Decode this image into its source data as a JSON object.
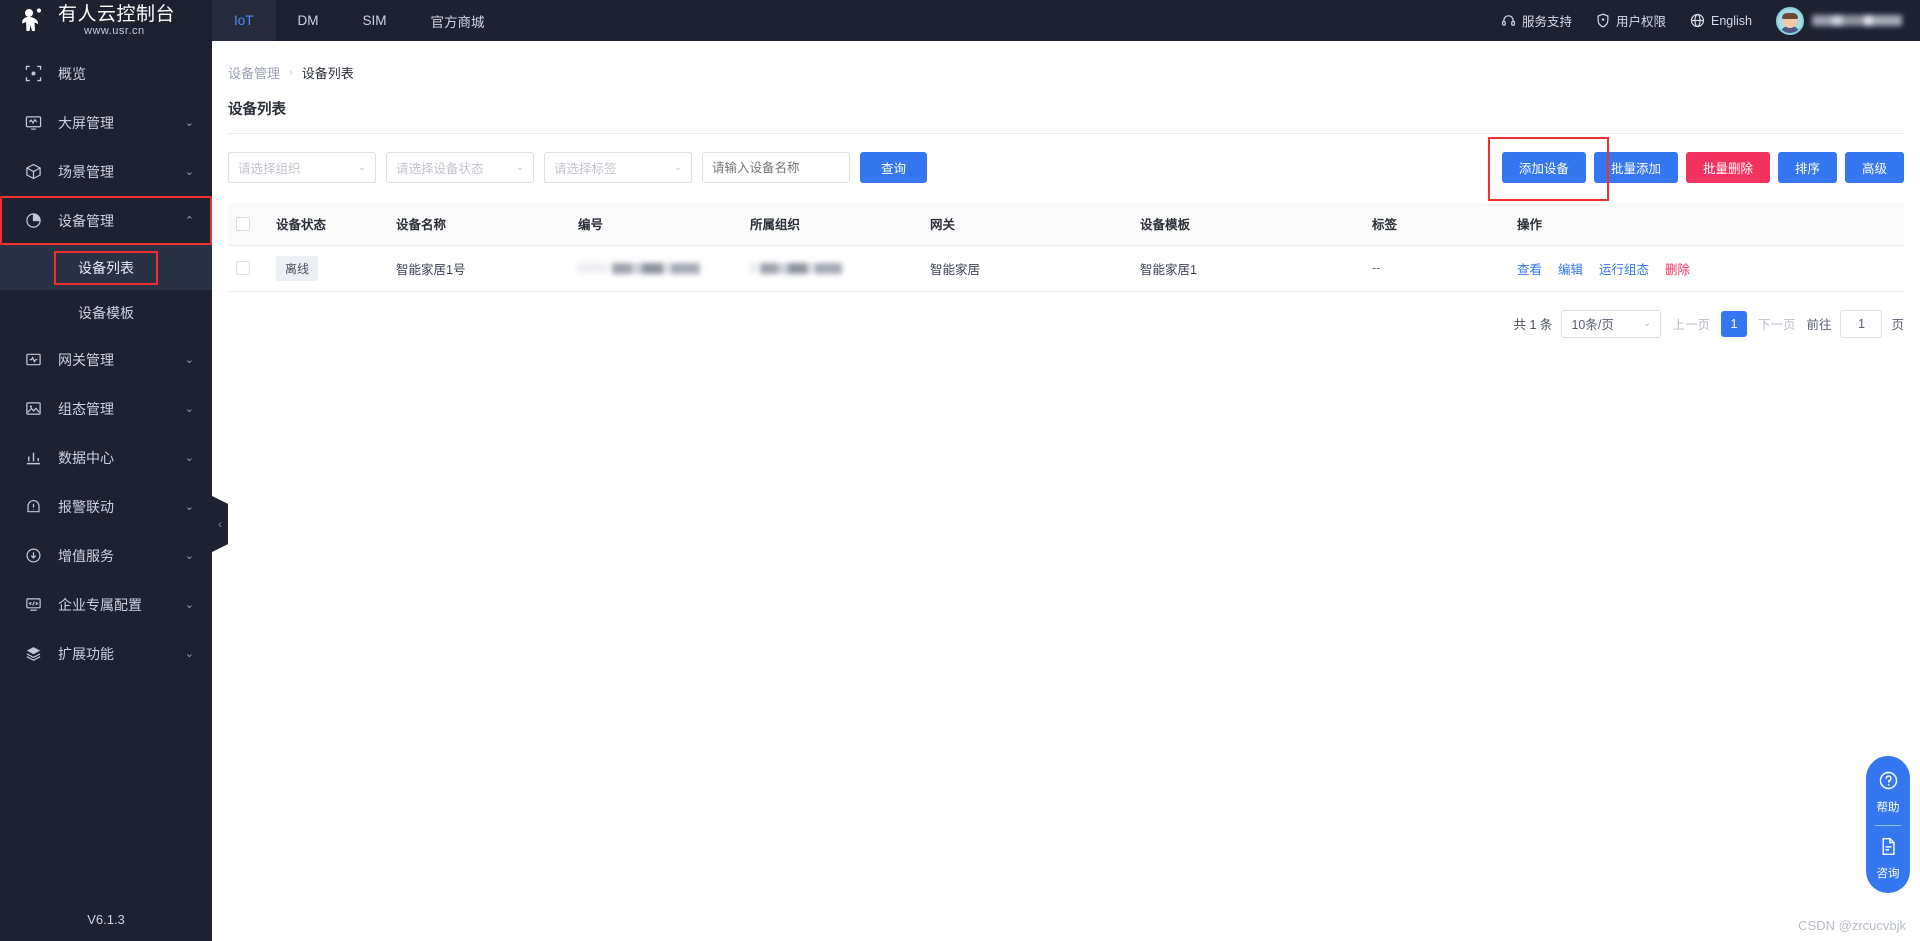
{
  "header": {
    "brand_title": "有人云控制台",
    "brand_sub": "www.usr.cn",
    "tabs": [
      {
        "label": "IoT",
        "active": true
      },
      {
        "label": "DM",
        "active": false
      },
      {
        "label": "SIM",
        "active": false
      },
      {
        "label": "官方商城",
        "active": false
      }
    ],
    "support_label": "服务支持",
    "permission_label": "用户权限",
    "language_label": "English",
    "username": "",
    "accent": "#4c8dfc",
    "background": "#1d2130"
  },
  "sidebar": {
    "version": "V6.1.3",
    "items": [
      {
        "label": "概览",
        "icon": "overview-icon",
        "chevron": "",
        "highlight": false
      },
      {
        "label": "大屏管理",
        "icon": "screen-icon",
        "chevron": "⌄",
        "highlight": false
      },
      {
        "label": "场景管理",
        "icon": "cube-icon",
        "chevron": "⌄",
        "highlight": false
      },
      {
        "label": "设备管理",
        "icon": "pie-icon",
        "chevron": "⌃",
        "highlight": true
      },
      {
        "label": "网关管理",
        "icon": "gateway-icon",
        "chevron": "⌄",
        "highlight": false
      },
      {
        "label": "组态管理",
        "icon": "image-icon",
        "chevron": "⌄",
        "highlight": false
      },
      {
        "label": "数据中心",
        "icon": "bar-chart-icon",
        "chevron": "⌄",
        "highlight": false
      },
      {
        "label": "报警联动",
        "icon": "alert-icon",
        "chevron": "⌄",
        "highlight": false
      },
      {
        "label": "增值服务",
        "icon": "value-added-icon",
        "chevron": "⌄",
        "highlight": false
      },
      {
        "label": "企业专属配置",
        "icon": "code-icon",
        "chevron": "⌄",
        "highlight": false
      },
      {
        "label": "扩展功能",
        "icon": "layers-icon",
        "chevron": "⌄",
        "highlight": false
      }
    ],
    "submenu": [
      {
        "label": "设备列表",
        "active": true,
        "highlight": true
      },
      {
        "label": "设备模板",
        "active": false,
        "highlight": false
      }
    ]
  },
  "breadcrumb": {
    "parent": "设备管理",
    "separator": "›",
    "current": "设备列表"
  },
  "page": {
    "title": "设备列表"
  },
  "filters": {
    "org_placeholder": "请选择组织",
    "status_placeholder": "请选择设备状态",
    "tag_placeholder": "请选择标签",
    "name_placeholder": "请输入设备名称",
    "name_value": "",
    "query_label": "查询"
  },
  "actions": {
    "add_device": "添加设备",
    "batch_add": "批量添加",
    "batch_delete": "批量删除",
    "sort": "排序",
    "advanced": "高级"
  },
  "table": {
    "columns": [
      "设备状态",
      "设备名称",
      "编号",
      "所属组织",
      "网关",
      "设备模板",
      "标签",
      "操作"
    ],
    "rows": [
      {
        "status": "离线",
        "name": "智能家居1号",
        "code": "0000",
        "code_blurred": true,
        "org": "9",
        "org_blurred": true,
        "gateway": "智能家居",
        "template": "智能家居1",
        "tag": "--",
        "operations": [
          {
            "label": "查看",
            "danger": false
          },
          {
            "label": "编辑",
            "danger": false
          },
          {
            "label": "运行组态",
            "danger": false
          },
          {
            "label": "删除",
            "danger": true
          }
        ]
      }
    ]
  },
  "pagination": {
    "total_label": "共 1 条",
    "page_size": "10条/页",
    "prev_label": "上一页",
    "current_page": "1",
    "next_label": "下一页",
    "goto_label": "前往",
    "goto_value": "1",
    "page_unit": "页"
  },
  "float_help": {
    "help_label": "帮助",
    "consult_label": "咨询",
    "color": "#3477f0"
  },
  "watermark": "CSDN @zrcucvbjk"
}
